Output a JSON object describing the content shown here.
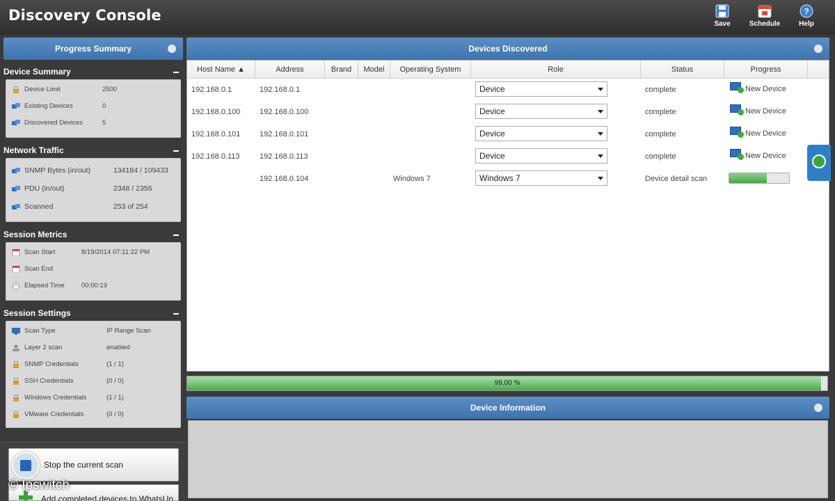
{
  "app": {
    "title": "Discovery Console"
  },
  "toolbar": {
    "save": "Save",
    "schedule": "Schedule",
    "help": "Help"
  },
  "left": {
    "panel_title": "Progress Summary",
    "device_summary": {
      "title": "Device Summary",
      "rows": [
        {
          "label": "Device Limit",
          "value": "2500"
        },
        {
          "label": "Existing Devices",
          "value": "0"
        },
        {
          "label": "Discovered Devices",
          "value": "5"
        }
      ]
    },
    "network_traffic": {
      "title": "Network Traffic",
      "rows": [
        {
          "label": "SNMP Bytes (in/out)",
          "value": "134184 / 109433"
        },
        {
          "label": "PDU (in/out)",
          "value": "2348 / 2356"
        },
        {
          "label": "Scanned",
          "value": "253 of 254"
        }
      ]
    },
    "session_metrics": {
      "title": "Session Metrics",
      "rows": [
        {
          "label": "Scan Start",
          "value": "8/19/2014 07:11:22 PM"
        },
        {
          "label": "Scan End",
          "value": ""
        },
        {
          "label": "Elapsed Time",
          "value": "00:00:19"
        }
      ]
    },
    "session_settings": {
      "title": "Session Settings",
      "rows": [
        {
          "label": "Scan Type",
          "value": "IP Range Scan"
        },
        {
          "label": "Layer 2 scan",
          "value": "enabled"
        },
        {
          "label": "SNMP Credentials",
          "value": "(1 / 1)"
        },
        {
          "label": "SSH Credentials",
          "value": "(0 / 0)"
        },
        {
          "label": "Windows Credentials",
          "value": "(1 / 1)"
        },
        {
          "label": "VMware Credentials",
          "value": "(0 / 0)"
        }
      ]
    },
    "stop_button": "Stop the current scan",
    "add_button": "Add completed devices to WhatsUp"
  },
  "devices": {
    "title": "Devices Discovered",
    "columns": [
      "Host Name ▲",
      "Address",
      "Brand",
      "Model",
      "Operating System",
      "Role",
      "Status",
      "Progress"
    ],
    "rows": [
      {
        "host": "192.168.0.1",
        "address": "192.168.0.1",
        "brand": "",
        "model": "",
        "os": "",
        "role": "Device",
        "status": "complete",
        "progress_text": "New Device"
      },
      {
        "host": "192.168.0.100",
        "address": "192.168.0.100",
        "brand": "",
        "model": "",
        "os": "",
        "role": "Device",
        "status": "complete",
        "progress_text": "New Device"
      },
      {
        "host": "192.168.0.101",
        "address": "192.168.0.101",
        "brand": "",
        "model": "",
        "os": "",
        "role": "Device",
        "status": "complete",
        "progress_text": "New Device"
      },
      {
        "host": "192.168.0.113",
        "address": "192.168.0.113",
        "brand": "",
        "model": "",
        "os": "",
        "role": "Device",
        "status": "complete",
        "progress_text": "New Device"
      },
      {
        "host": "",
        "address": "192.168.0.104",
        "brand": "",
        "model": "",
        "os": "Windows 7",
        "role": "Windows 7",
        "status": "Device detail scan",
        "progress_fraction": 0.63
      }
    ]
  },
  "overall_progress": {
    "label": "99.00 %",
    "fraction": 0.99
  },
  "device_info": {
    "title": "Device Information"
  },
  "watermark": "© Ipswitch",
  "colors": {
    "header_blue": "#3e73ad",
    "progress_green": "#4caa4c",
    "background": "#3a3a3a"
  }
}
